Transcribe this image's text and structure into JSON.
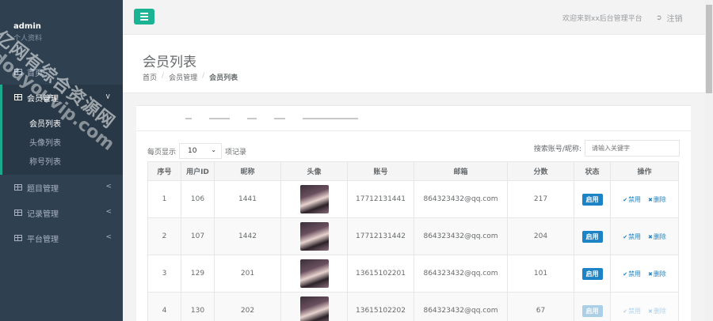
{
  "sidebar": {
    "user": "admin",
    "user_sub": "个人资料",
    "items": [
      {
        "label": "首页"
      },
      {
        "label": "会员管理"
      },
      {
        "label": "题目管理"
      },
      {
        "label": "记录管理"
      },
      {
        "label": "平台管理"
      }
    ],
    "submenu": [
      {
        "label": "会员列表"
      },
      {
        "label": "头像列表"
      },
      {
        "label": "称号列表"
      }
    ]
  },
  "topbar": {
    "welcome": "欢迎来到xx后台管理平台",
    "logout": "注销"
  },
  "header": {
    "title": "会员列表",
    "breadcrumb": [
      "首页",
      "会员管理",
      "会员列表"
    ]
  },
  "controls": {
    "length_prefix": "每页显示",
    "length_value": "10",
    "length_suffix": "项记录",
    "search_label": "搜索账号/昵称:",
    "search_placeholder": "请输入关键字"
  },
  "table": {
    "headers": [
      "序号",
      "用户ID",
      "昵称",
      "头像",
      "账号",
      "邮箱",
      "分数",
      "状态",
      "操作"
    ],
    "rows": [
      {
        "no": "1",
        "uid": "106",
        "nick": "1441",
        "account": "17712131441",
        "email": "864323432@qq.com",
        "score": "217",
        "status": "启用",
        "disable": "禁用",
        "delete": "删除"
      },
      {
        "no": "2",
        "uid": "107",
        "nick": "1442",
        "account": "17712131442",
        "email": "864323432@qq.com",
        "score": "204",
        "status": "启用",
        "disable": "禁用",
        "delete": "删除"
      },
      {
        "no": "3",
        "uid": "129",
        "nick": "201",
        "account": "13615102201",
        "email": "864323432@qq.com",
        "score": "101",
        "status": "启用",
        "disable": "禁用",
        "delete": "删除"
      },
      {
        "no": "4",
        "uid": "130",
        "nick": "202",
        "account": "13615102202",
        "email": "864323432@qq.com",
        "score": "67",
        "status": "启用",
        "disable": "禁用",
        "delete": "删除"
      }
    ]
  },
  "watermark": {
    "line1": "亿网有综合资源网",
    "line2": "douyouvip.com"
  },
  "colors": {
    "sidebar_bg": "#2f4050",
    "accent_green": "#1ab394",
    "badge_blue": "#1c84c6"
  }
}
